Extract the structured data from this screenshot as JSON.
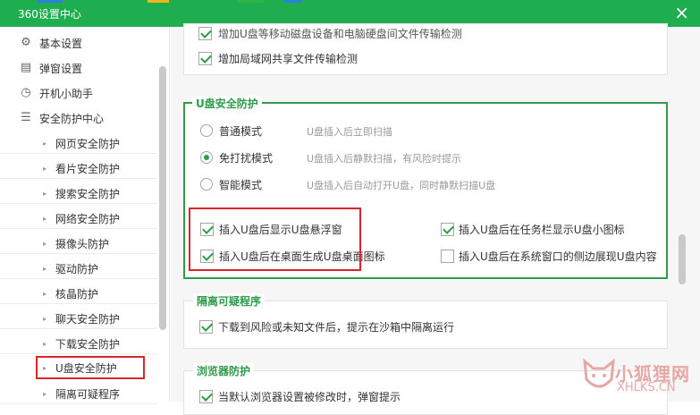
{
  "window": {
    "title": "360设置中心",
    "close_glyph": "×"
  },
  "strip_colors": [
    "#2f7ed8",
    "#f2b51c",
    "#2fb347",
    "#2f7ed8"
  ],
  "sidebar": {
    "top_items": [
      {
        "label": "基本设置",
        "icon": "gear-icon",
        "glyph": "⚙"
      },
      {
        "label": "弹窗设置",
        "icon": "window-icon",
        "glyph": "▤"
      },
      {
        "label": "开机小助手",
        "icon": "timer-icon",
        "glyph": "◷"
      },
      {
        "label": "安全防护中心",
        "icon": "list-icon",
        "glyph": "☰"
      }
    ],
    "sub_items": [
      "网页安全防护",
      "看片安全防护",
      "搜索安全防护",
      "网络安全防护",
      "摄像头防护",
      "驱动防护",
      "核晶防护",
      "聊天安全防护",
      "下载安全防护",
      "U盘安全防护",
      "隔离可疑程序"
    ],
    "active_index": 9
  },
  "top_options": [
    {
      "label": "增加U盘等移动磁盘设备和电脑硬盘间文件传输检测",
      "checked": true
    },
    {
      "label": "增加局域网共享文件传输检测",
      "checked": true
    }
  ],
  "usb_section": {
    "title": "U盘安全防护",
    "modes": [
      {
        "label": "普通模式",
        "desc": "U盘插入后立即扫描",
        "selected": false
      },
      {
        "label": "免打扰模式",
        "desc": "U盘插入后静默扫描，有风险时提示",
        "selected": true
      },
      {
        "label": "智能模式",
        "desc": "U盘插入后自动打开U盘，同时静默扫描U盘",
        "selected": false
      }
    ],
    "options": [
      {
        "label": "插入U盘后显示U盘悬浮窗",
        "checked": true
      },
      {
        "label": "插入U盘后在任务栏显示U盘小图标",
        "checked": true
      },
      {
        "label": "插入U盘后在桌面生成U盘桌面图标",
        "checked": true
      },
      {
        "label": "插入U盘后在系统窗口的侧边展现U盘内容",
        "checked": false
      }
    ]
  },
  "quarantine_section": {
    "title": "隔离可疑程序",
    "option": {
      "label": "下载到风险或未知文件后，提示在沙箱中隔离运行",
      "checked": true
    }
  },
  "browser_section": {
    "title": "浏览器防护",
    "option": {
      "label": "当默认浏览器设置被修改时，弹窗提示",
      "checked": true
    }
  },
  "watermark": {
    "text": "小狐狸网",
    "sub": "XHLKS.CN"
  }
}
